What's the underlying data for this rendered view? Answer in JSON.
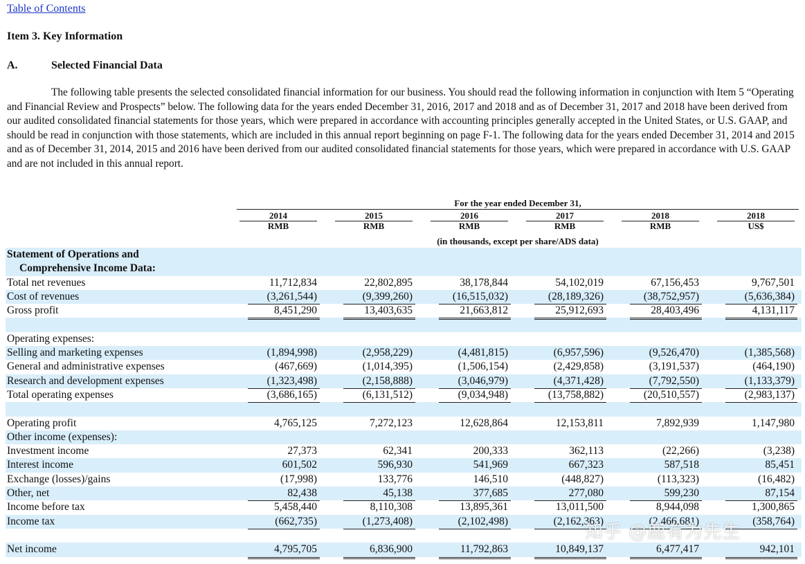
{
  "toc_link": "Table of Contents",
  "item_heading": "Item 3.  Key Information",
  "section": {
    "letter": "A.",
    "title": "Selected Financial Data"
  },
  "intro_paragraph": "The following table presents the selected consolidated financial information for our business. You should read the following information in conjunction with Item 5 “Operating and Financial Review and Prospects” below. The following data for the years ended December 31, 2016, 2017 and 2018 and as of December 31, 2017 and 2018 have been derived from our audited consolidated financial statements for those years, which were prepared in accordance with accounting principles generally accepted in the United States, or U.S. GAAP, and should be read in conjunction with those statements, which are included in this annual report beginning on page F-1. The following data for the years ended December 31, 2014 and 2015 and as of December 31, 2014, 2015 and 2016 have been derived from our audited consolidated financial statements for those years, which were prepared in accordance with U.S. GAAP and are not included in this annual report.",
  "table": {
    "header_top": "For the year ended December 31,",
    "header_sub": "(in thousands, except per share/ADS data)",
    "columns": [
      {
        "year": "2014",
        "currency": "RMB"
      },
      {
        "year": "2015",
        "currency": "RMB"
      },
      {
        "year": "2016",
        "currency": "RMB"
      },
      {
        "year": "2017",
        "currency": "RMB"
      },
      {
        "year": "2018",
        "currency": "RMB"
      },
      {
        "year": "2018",
        "currency": "US$"
      }
    ],
    "section_title_line1": "Statement of Operations and",
    "section_title_line2": "Comprehensive Income Data:",
    "rows": {
      "total_net_revenues": {
        "label": "Total net revenues",
        "values": [
          "11,712,834",
          "22,802,895",
          "38,178,844",
          "54,102,019",
          "67,156,453",
          "9,767,501"
        ]
      },
      "cost_of_revenues": {
        "label": "Cost of revenues",
        "values": [
          "(3,261,544)",
          "(9,399,260)",
          "(16,515,032)",
          "(28,189,326)",
          "(38,752,957)",
          "(5,636,384)"
        ]
      },
      "gross_profit": {
        "label": "Gross profit",
        "values": [
          "8,451,290",
          "13,403,635",
          "21,663,812",
          "25,912,693",
          "28,403,496",
          "4,131,117"
        ]
      },
      "operating_expenses_label": {
        "label": "Operating expenses:"
      },
      "selling_marketing": {
        "label": "Selling and marketing expenses",
        "values": [
          "(1,894,998)",
          "(2,958,229)",
          "(4,481,815)",
          "(6,957,596)",
          "(9,526,470)",
          "(1,385,568)"
        ]
      },
      "general_admin": {
        "label": "General and administrative expenses",
        "values": [
          "(467,669)",
          "(1,014,395)",
          "(1,506,154)",
          "(2,429,858)",
          "(3,191,537)",
          "(464,190)"
        ]
      },
      "research_dev": {
        "label": "Research and development expenses",
        "values": [
          "(1,323,498)",
          "(2,158,888)",
          "(3,046,979)",
          "(4,371,428)",
          "(7,792,550)",
          "(1,133,379)"
        ]
      },
      "total_operating": {
        "label": "Total operating expenses",
        "values": [
          "(3,686,165)",
          "(6,131,512)",
          "(9,034,948)",
          "(13,758,882)",
          "(20,510,557)",
          "(2,983,137)"
        ]
      },
      "operating_profit": {
        "label": "Operating profit",
        "values": [
          "4,765,125",
          "7,272,123",
          "12,628,864",
          "12,153,811",
          "7,892,939",
          "1,147,980"
        ]
      },
      "other_income_label": {
        "label": "Other income (expenses):"
      },
      "investment_income": {
        "label": "Investment income",
        "values": [
          "27,373",
          "62,341",
          "200,333",
          "362,113",
          "(22,266)",
          "(3,238)"
        ]
      },
      "interest_income": {
        "label": "Interest income",
        "values": [
          "601,502",
          "596,930",
          "541,969",
          "667,323",
          "587,518",
          "85,451"
        ]
      },
      "exchange": {
        "label": "Exchange (losses)/gains",
        "values": [
          "(17,998)",
          "133,776",
          "146,510",
          "(448,827)",
          "(113,323)",
          "(16,482)"
        ]
      },
      "other_net": {
        "label": "Other, net",
        "values": [
          "82,438",
          "45,138",
          "377,685",
          "277,080",
          "599,230",
          "87,154"
        ]
      },
      "income_before_tax": {
        "label": "Income before tax",
        "values": [
          "5,458,440",
          "8,110,308",
          "13,895,361",
          "13,011,500",
          "8,944,098",
          "1,300,865"
        ]
      },
      "income_tax": {
        "label": "Income tax",
        "values": [
          "(662,735)",
          "(1,273,408)",
          "(2,102,498)",
          "(2,162,363)",
          "(2,466,681)",
          "(358,764)"
        ]
      },
      "net_income": {
        "label": "Net income",
        "values": [
          "4,795,705",
          "6,836,900",
          "11,792,863",
          "10,849,137",
          "6,477,417",
          "942,101"
        ]
      }
    }
  },
  "watermark": "知乎 @鹿有为先生"
}
